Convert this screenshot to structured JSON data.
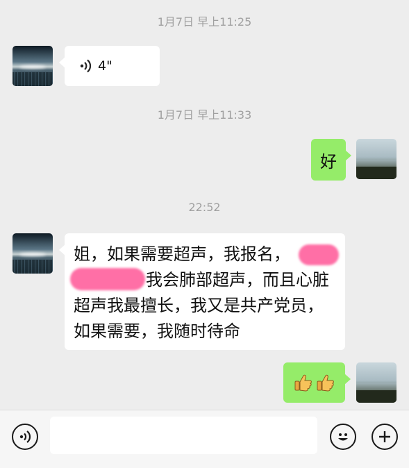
{
  "chat": {
    "timestamps": [
      "1月7日 早上11:25",
      "1月7日 早上11:33",
      "22:52"
    ],
    "messages": [
      {
        "sender": "contact",
        "type": "voice",
        "duration": "4\""
      },
      {
        "sender": "me",
        "type": "text",
        "text": "好"
      },
      {
        "sender": "contact",
        "type": "text",
        "lines": [
          "姐，如果需要超声，我报名，",
          "我会肺部超声，而且心脏",
          "超声我最擅长，我又是共产党员，",
          "如果需要，我随时待命"
        ],
        "redaction_color": "#ff6fa6"
      },
      {
        "sender": "me",
        "type": "emoji",
        "emojis": [
          "👍",
          "👍"
        ]
      }
    ]
  },
  "colors": {
    "background": "#ededed",
    "my_bubble": "#95ec69",
    "contact_bubble": "#ffffff",
    "timestamp_text": "#a0a0a0"
  },
  "input_bar": {
    "voice_button_icon": "voice-icon",
    "emoji_button_icon": "smiley-icon",
    "more_button_icon": "plus-icon",
    "message_value": ""
  }
}
